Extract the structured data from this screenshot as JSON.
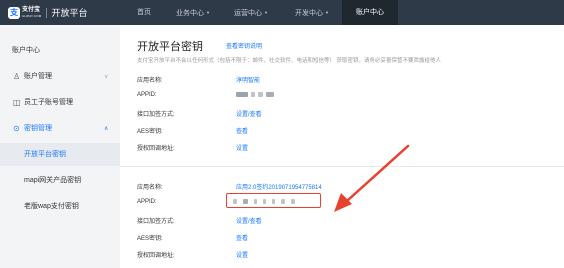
{
  "logo": {
    "mark": "支",
    "cn_top": "支付宝",
    "cn_bottom": "ALIPAY.COM",
    "title": "开放平台"
  },
  "nav": [
    {
      "label": "首页",
      "caret": ""
    },
    {
      "label": "业务中心",
      "caret": "▼"
    },
    {
      "label": "运营中心",
      "caret": "▼"
    },
    {
      "label": "开发中心",
      "caret": "▼"
    },
    {
      "label": "账户中心",
      "caret": ""
    }
  ],
  "sidebar": {
    "items": [
      {
        "label": "账户中心"
      },
      {
        "label": "账户管理",
        "icon": "user-icon"
      },
      {
        "label": "员工子账号管理",
        "icon": "staff-icon"
      },
      {
        "label": "密钥管理",
        "icon": "key-icon"
      },
      {
        "label": "开放平台密钥"
      },
      {
        "label": "mapi网关产品密钥"
      },
      {
        "label": "老版wap支付密钥"
      }
    ]
  },
  "main": {
    "title": "开放平台密钥",
    "doc_link": "查看密钥说明",
    "description": "支付宝开放平台不会以任何形式（包括不限于：邮件、社交软件、电话和短信等） 获取密钥，请务必妥善保管不要泄露给他人",
    "apps": [
      {
        "name_label": "应用名称:",
        "name_value": "淳明智能",
        "appid_label": "APPID:",
        "sign_label": "接口加签方式:",
        "sign_value": "设置/查看",
        "aes_label": "AES密钥:",
        "aes_value": "查看",
        "callback_label": "授权回调地址:",
        "callback_value": "设置"
      },
      {
        "name_label": "应用名称:",
        "name_value": "应用2.0签约2019071954775814",
        "appid_label": "APPID:",
        "sign_label": "接口加签方式:",
        "sign_value": "设置/查看",
        "aes_label": "AES密钥:",
        "aes_value": "查看",
        "callback_label": "授权回调地址:",
        "callback_value": "设置"
      }
    ]
  },
  "colors": {
    "accent": "#1677ff",
    "topbar": "#2f3a49",
    "highlight": "#e8412e"
  }
}
